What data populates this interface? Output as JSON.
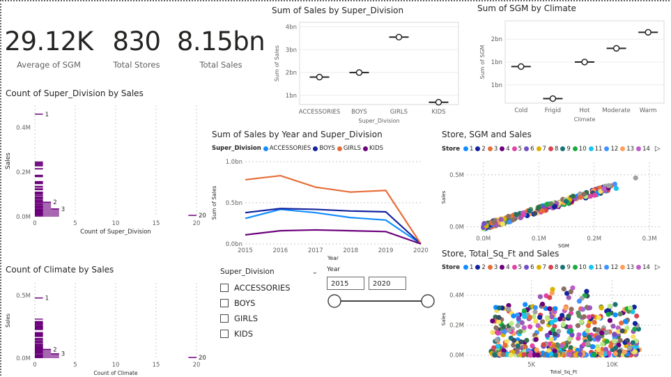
{
  "kpis": {
    "avg_sgm": {
      "value": "29.12K",
      "label": "Average of SGM"
    },
    "total_stores": {
      "value": "830",
      "label": "Total Stores"
    },
    "total_sales": {
      "value": "8.15bn",
      "label": "Total Sales"
    }
  },
  "visual_titles": {
    "sales_by_superdiv": "Sum of Sales by Super_Division",
    "sgm_by_climate": "Sum of SGM by Climate",
    "count_superdiv": "Count of Super_Division by Sales",
    "count_climate": "Count of Climate by Sales",
    "sales_year_superdiv": "Sum of Sales by Year and Super_Division",
    "store_sgm_sales": "Store, SGM and Sales",
    "store_sqft_sales": "Store, Total_Sq_Ft and Sales"
  },
  "slicer_superdiv": {
    "title": "Super_Division",
    "options": [
      "ACCESSORIES",
      "BOYS",
      "GIRLS",
      "KIDS"
    ]
  },
  "slicer_year": {
    "title": "Year",
    "start": "2015",
    "end": "2020"
  },
  "store_legend": {
    "title": "Store",
    "items": [
      "1",
      "2",
      "3",
      "4",
      "5",
      "6",
      "7",
      "8",
      "9",
      "10",
      "11",
      "12",
      "13",
      "14"
    ],
    "colors": [
      "#118DFF",
      "#12239E",
      "#E66C37",
      "#6B007B",
      "#E044A7",
      "#744EC2",
      "#D9B300",
      "#D64550",
      "#197278",
      "#1AAB40",
      "#15C6F4",
      "#4092FF",
      "#FFA058",
      "#BE5DC9"
    ]
  },
  "colors": {
    "accessories": "#118DFF",
    "boys": "#12239E",
    "girls": "#E66C37",
    "kids": "#6B007B",
    "purple": "#6B007B"
  },
  "chart_data": [
    {
      "type": "scatter",
      "title": "Sum of Sales by Super_Division",
      "categories": [
        "ACCESSORIES",
        "BOYS",
        "GIRLS",
        "KIDS"
      ],
      "values": [
        1.8,
        2.0,
        3.55,
        0.7
      ],
      "xlabel": "Super_Division",
      "ylabel": "Sum of Sales",
      "yticks": [
        "1bn",
        "2bn",
        "3bn",
        "4bn"
      ],
      "ylim": [
        0.6,
        4.2
      ]
    },
    {
      "type": "scatter",
      "title": "Sum of SGM by Climate",
      "categories": [
        "Cold",
        "Frigid",
        "Hot",
        "Moderate",
        "Warm"
      ],
      "values": [
        1.4,
        0.7,
        1.5,
        1.8,
        2.15
      ],
      "xlabel": "Climate",
      "ylabel": "Sum of SGM",
      "yticks": [
        "1bn",
        "1bn",
        "2bn"
      ],
      "ylim": [
        0.6,
        2.4
      ]
    },
    {
      "type": "line",
      "title": "Sum of Sales by Year and Super_Division",
      "legend_title": "Super_Division",
      "x": [
        "2015",
        "2016",
        "2017",
        "2018",
        "2019",
        "2020"
      ],
      "series": [
        {
          "name": "ACCESSORIES",
          "values": [
            0.31,
            0.42,
            0.38,
            0.32,
            0.29,
            0.0
          ]
        },
        {
          "name": "BOYS",
          "values": [
            0.38,
            0.43,
            0.42,
            0.4,
            0.39,
            0.0
          ]
        },
        {
          "name": "GIRLS",
          "values": [
            0.78,
            0.83,
            0.69,
            0.63,
            0.65,
            0.0
          ]
        },
        {
          "name": "KIDS",
          "values": [
            0.11,
            0.16,
            0.17,
            0.16,
            0.15,
            0.0
          ]
        }
      ],
      "xlabel": "Year",
      "ylabel": "Sum of Sales",
      "yticks": [
        "0.0bn",
        "0.5bn",
        "1.0bn"
      ],
      "ylim": [
        0,
        1.0
      ]
    },
    {
      "type": "bar",
      "title": "Count of Super_Division by Sales",
      "xlabel": "Count of Super_Division",
      "ylabel": "Sales",
      "xticks": [
        "0",
        "5",
        "10",
        "15",
        "20"
      ],
      "yticks": [
        "0.0M",
        "0.2M",
        "0.4M"
      ],
      "xlim": [
        0,
        20
      ],
      "ylim": [
        0,
        0.5
      ],
      "data_labels": [
        {
          "label": "1",
          "x": 1,
          "y": 0.46
        },
        {
          "label": "2",
          "x": 2,
          "y": 0.065
        },
        {
          "label": "3",
          "x": 3,
          "y": 0.035
        },
        {
          "label": "20",
          "x": 20,
          "y": 0.006
        }
      ]
    },
    {
      "type": "bar",
      "title": "Count of Climate by Sales",
      "xlabel": "Count of Climate",
      "ylabel": "Sales",
      "xticks": [
        "0",
        "5",
        "10",
        "15",
        "20"
      ],
      "yticks": [
        "0.0M",
        "0.5M"
      ],
      "xlim": [
        0,
        20
      ],
      "ylim": [
        0,
        0.6
      ],
      "data_labels": [
        {
          "label": "1",
          "x": 1,
          "y": 0.48
        },
        {
          "label": "2",
          "x": 2,
          "y": 0.07
        },
        {
          "label": "3",
          "x": 3,
          "y": 0.035
        },
        {
          "label": "20",
          "x": 20,
          "y": 0.006
        }
      ]
    },
    {
      "type": "scatter",
      "title": "Store, SGM and Sales",
      "xlabel": "SGM",
      "ylabel": "Sales",
      "xticks": [
        "0.0M",
        "0.1M",
        "0.2M",
        "0.3M"
      ],
      "yticks": [
        "0.0M",
        "0.5M"
      ],
      "xlim": [
        -0.03,
        0.32
      ],
      "ylim": [
        -0.05,
        0.62
      ]
    },
    {
      "type": "scatter",
      "title": "Store, Total_Sq_Ft and Sales",
      "xlabel": "Total_Sq_Ft",
      "ylabel": "Sales",
      "xticks": [
        "5K",
        "10K"
      ],
      "yticks": [
        "0.0M",
        "0.2M",
        "0.4M"
      ],
      "xlim": [
        1000,
        13000
      ],
      "ylim": [
        -0.02,
        0.5
      ]
    }
  ]
}
